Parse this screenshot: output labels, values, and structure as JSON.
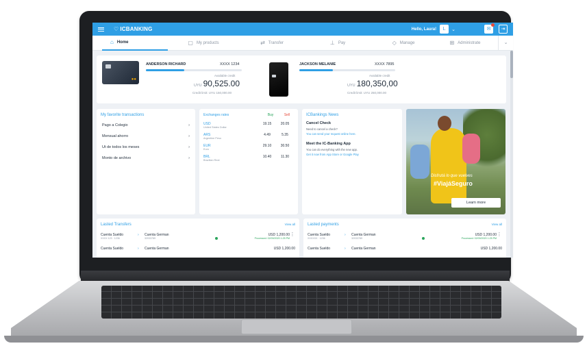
{
  "app": {
    "logo": "ICBANKING",
    "greeting": "Hello, Laura!",
    "avatar_initial": "L",
    "notification_count_visible": true
  },
  "tabs": [
    {
      "label": "Home",
      "icon": "home-icon",
      "active": true
    },
    {
      "label": "My products",
      "icon": "products-icon",
      "active": false
    },
    {
      "label": "Transfer",
      "icon": "transfer-icon",
      "active": false
    },
    {
      "label": "Pay",
      "icon": "pay-icon",
      "active": false
    },
    {
      "label": "Manage",
      "icon": "manage-icon",
      "active": false
    },
    {
      "label": "Administrate",
      "icon": "administrate-icon",
      "active": false
    }
  ],
  "cards": [
    {
      "holder": "ANDERSON RICHARD",
      "number": "XXXX 1234",
      "available_label": "Available credit",
      "currency": "UYU",
      "balance": "90,525.00",
      "limit": "Credit limit: UYU 150,000.00",
      "used_fraction": 0.4
    },
    {
      "holder": "JACKSON MELANIE",
      "number": "XXXX 7895",
      "available_label": "Available credit",
      "currency": "UYU",
      "balance": "180,350,00",
      "limit": "Credit limit: UYU 250,000.00",
      "used_fraction": 0.35
    }
  ],
  "favorites": {
    "title": "My favorite transactions",
    "items": [
      "Pago a Colegio",
      "Mensual ahorro",
      "Ut de todos los meses",
      "Monto de archivo"
    ]
  },
  "exchange": {
    "title": "Exchanges rates",
    "buy_label": "Buy",
    "sell_label": "Sell",
    "rows": [
      {
        "code": "USD",
        "name": "United States Dollar",
        "buy": "19.15",
        "sell": "20.05"
      },
      {
        "code": "ARS",
        "name": "Argentine Peso",
        "buy": "4.49",
        "sell": "5.35"
      },
      {
        "code": "EUR",
        "name": "Euro",
        "buy": "29.10",
        "sell": "30.50"
      },
      {
        "code": "BRL",
        "name": "Brazilian Real",
        "buy": "10.40",
        "sell": "11.30"
      }
    ]
  },
  "news": {
    "title": "ICBankings News",
    "items": [
      {
        "heading": "Cancel Check",
        "lines": [
          "Need to cancel a check?",
          "You can send your request online here."
        ],
        "link": "here"
      },
      {
        "heading": "Meet the IC-Banking App",
        "lines": [
          "You can do everything with the new app.",
          "Get it now from App Store or Google Play"
        ],
        "link": "App Store or Google Play"
      }
    ]
  },
  "promo": {
    "tagline": "Disfrutá lo que vuelves",
    "hashtag": "#ViajáSeguro",
    "button": "Learn more"
  },
  "last_transfers": {
    "title": "Lasted Transfers",
    "view_all": "View all",
    "rows": [
      {
        "from": "Cuenta Sueldo",
        "from_sub": "XXXX 123 · 1236",
        "to": "Cuenta German",
        "to_sub": "32033789",
        "amount": "USD 1,200.00",
        "status": "Processed: 02/09/2020 1:25 PM"
      },
      {
        "from": "Cuenta Sueldo",
        "from_sub": "",
        "to": "Cuenta German",
        "to_sub": "",
        "amount": "USD 1,200.00",
        "status": ""
      }
    ]
  },
  "last_payments": {
    "title": "Lasted payments",
    "view_all": "View all",
    "rows": [
      {
        "from": "Cuenta Sueldo",
        "from_sub": "XXXXXX · 1236",
        "to": "Cuenta German",
        "to_sub": "32033789",
        "amount": "USD 1,200.00",
        "status": "Processed: 02/09/2020 1:25 PM"
      },
      {
        "from": "Cuenta Sueldo",
        "from_sub": "",
        "to": "Cuenta German",
        "to_sub": "",
        "amount": "USD 1,200.00",
        "status": ""
      }
    ]
  },
  "colors": {
    "accent": "#2f9fe5",
    "buy": "#2ba55c",
    "sell": "#e64b3b"
  }
}
